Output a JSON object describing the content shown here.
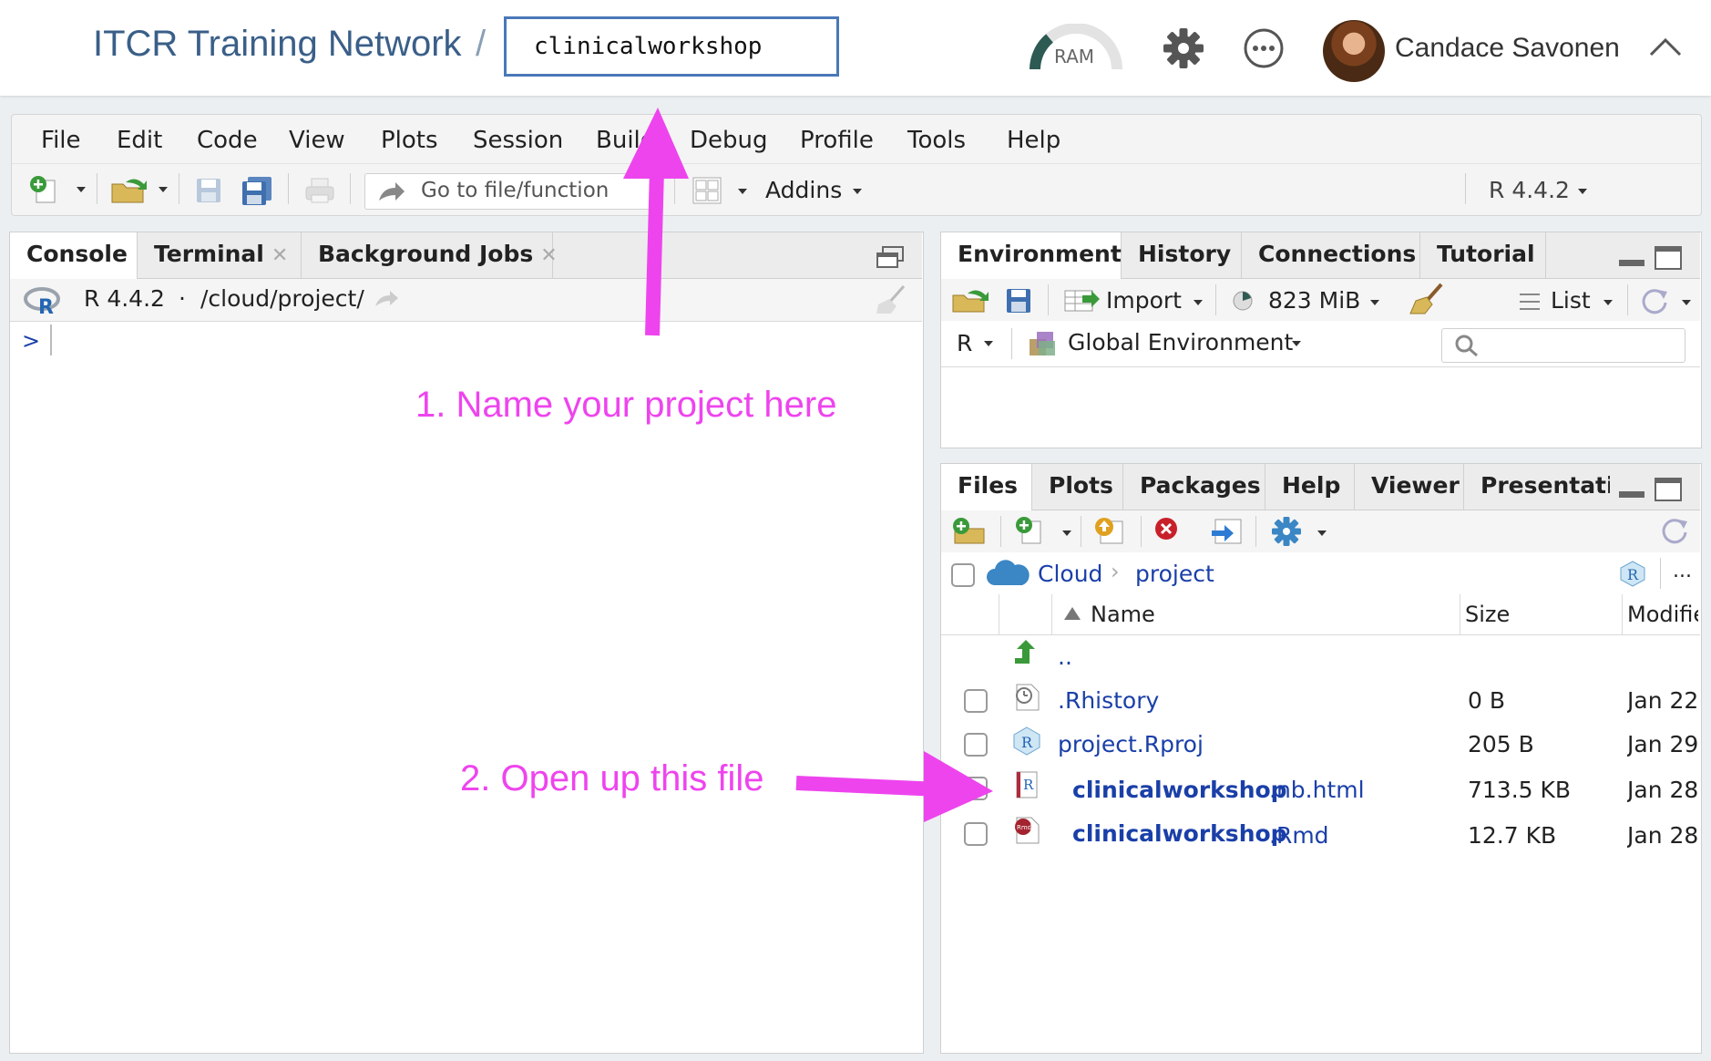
{
  "header": {
    "org_name": "ITCR Training Network",
    "separator": "/",
    "project_name": "clinicalworkshop",
    "ram_label": "RAM",
    "user_name": "Candace Savonen"
  },
  "menu": [
    "File",
    "Edit",
    "Code",
    "View",
    "Plots",
    "Session",
    "Build",
    "Debug",
    "Profile",
    "Tools",
    "Help"
  ],
  "toolbar": {
    "goto_placeholder": "Go to file/function",
    "addins_label": "Addins",
    "r_version": "R 4.4.2"
  },
  "console_pane": {
    "tabs": [
      "Console",
      "Terminal",
      "Background Jobs"
    ],
    "r_version": "R 4.4.2",
    "path": "/cloud/project/",
    "prompt": ">"
  },
  "env_pane": {
    "tabs": [
      "Environment",
      "History",
      "Connections",
      "Tutorial"
    ],
    "import_label": "Import",
    "memory": "823 MiB",
    "view_mode": "List",
    "language": "R",
    "scope": "Global Environment"
  },
  "files_pane": {
    "tabs": [
      "Files",
      "Plots",
      "Packages",
      "Help",
      "Viewer",
      "Presentati"
    ],
    "breadcrumb": [
      "Cloud",
      "project"
    ],
    "more": "...",
    "columns": {
      "name": "Name",
      "size": "Size",
      "modified": "Modifie"
    },
    "parent": "..",
    "rows": [
      {
        "name": ".Rhistory",
        "size": "0 B",
        "modified": "Jan 22"
      },
      {
        "name": "project.Rproj",
        "size": "205 B",
        "modified": "Jan 29"
      },
      {
        "name": "clinicalworkshop",
        "ext": ".nb.html",
        "size": "713.5 KB",
        "modified": "Jan 28"
      },
      {
        "name": "clinicalworkshop",
        "ext": ".Rmd",
        "size": "12.7 KB",
        "modified": "Jan 28"
      }
    ]
  },
  "annotations": {
    "step1": "1. Name your project here",
    "step2": "2. Open up this file"
  },
  "colors": {
    "annotation": "#ee44ee",
    "link": "#1a3fa8",
    "header_text": "#3a5f88"
  }
}
